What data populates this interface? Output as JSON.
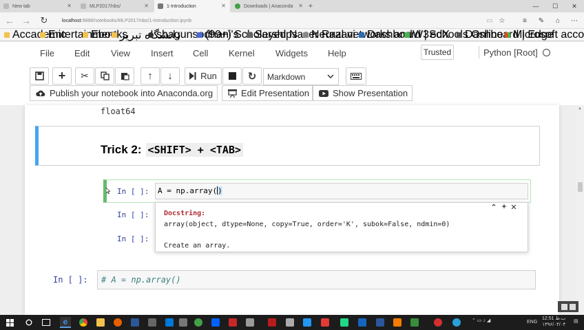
{
  "browser": {
    "tabs": [
      {
        "label": "New tab"
      },
      {
        "label": "MLP2017/nbs/"
      },
      {
        "label": "1-Introduction"
      },
      {
        "label": "Downloads | Anaconda"
      }
    ],
    "address": {
      "host": "localhost",
      "path": ":8888/notebooks/MLP2017/nbs/1-Introduction.ipynb"
    },
    "bookmarks": [
      {
        "label": "Accademic",
        "color": "#f2c14e"
      },
      {
        "label": "Entertainment",
        "color": "#f2c14e"
      },
      {
        "label": "Ebooks",
        "color": "#f2c14e"
      },
      {
        "label": "دانشگاه تبریز",
        "color": "#f2c14e"
      },
      {
        "label": "shagunsodhani's",
        "color": "#333333"
      },
      {
        "label": "(99+) Scholarships",
        "color": "#4a6cd4"
      },
      {
        "label": "Seyed Naser Razavi -",
        "color": "#666666"
      },
      {
        "label": "Neural networks and",
        "color": "#888888"
      },
      {
        "label": "Dashboard | edX",
        "color": "#2b6cb0"
      },
      {
        "label": "W3Schools Online",
        "color": "#4caf50"
      },
      {
        "label": "Dashboard | Edge",
        "color": "#555555"
      },
      {
        "label": "Microsoft account |",
        "color": "#e64a19"
      }
    ]
  },
  "jupyter": {
    "menu": [
      "File",
      "Edit",
      "View",
      "Insert",
      "Cell",
      "Kernel",
      "Widgets",
      "Help"
    ],
    "trusted_label": "Trusted",
    "kernel_name": "Python [Root]",
    "toolbar": {
      "run_label": "Run",
      "cell_type": "Markdown",
      "publish_label": "Publish your notebook into Anaconda.org",
      "edit_presentation_label": "Edit Presentation",
      "show_presentation_label": "Show Presentation"
    }
  },
  "notebook": {
    "output_text": "float64",
    "markdown_heading": "Trick 2:",
    "markdown_code": "<SHIFT> + <TAB>",
    "active_cell": {
      "prompt": "In [ ]:",
      "code": "A = np.array("
    },
    "hidden_prompts": [
      "In [ ]:",
      "In [ ]:"
    ],
    "tooltip": {
      "title": "Docstring:",
      "signature": "array(object, dtype=None, copy=True, order='K', subok=False, ndmin=0)",
      "description": "Create an array."
    },
    "last_cell": {
      "prompt": "In [ ]:",
      "code": "# A = np.array()"
    }
  },
  "taskbar": {
    "lang": "ENG",
    "time": "12:51 ب.ظ",
    "date": "۱۳۹۶/۰۴/۰۴"
  }
}
